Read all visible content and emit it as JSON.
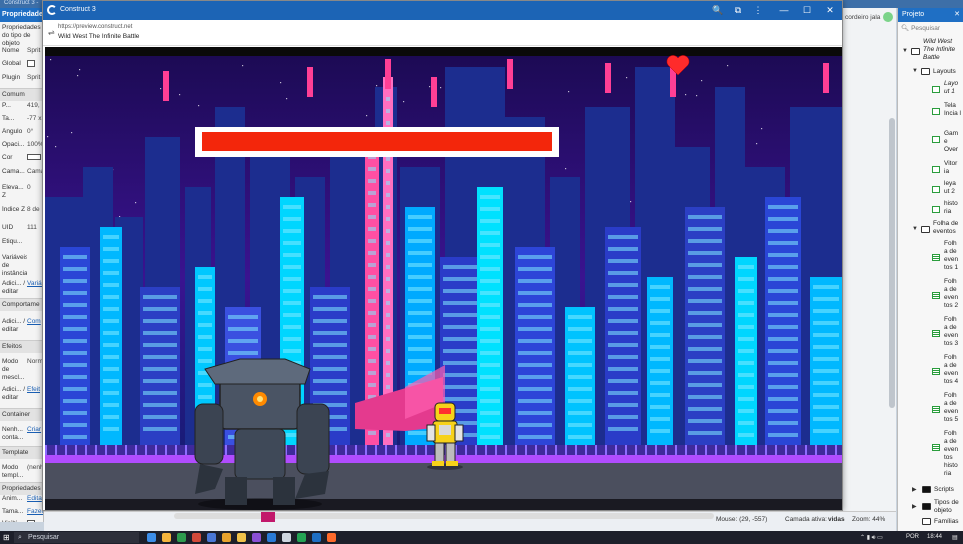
{
  "editor": {
    "top_left_title": "Construct 3 -",
    "right_tab": "cordeiro jala"
  },
  "properties_panel": {
    "header": "Propriedades",
    "subheader": "Propriedades do tipo de objeto",
    "rows": [
      {
        "label": "Nome",
        "value": "Sprit"
      },
      {
        "label": "Global",
        "value": ""
      },
      {
        "label": "Plugin",
        "value": "Sprit"
      },
      {
        "section": "Comum"
      },
      {
        "label": "P...",
        "value": "419,"
      },
      {
        "label": "Ta...",
        "value": "-77 x"
      },
      {
        "label": "Ângulo",
        "value": "0°"
      },
      {
        "label": "Opaci...",
        "value": "100%"
      },
      {
        "label": "Cor",
        "value": ""
      },
      {
        "label": "Cama...",
        "value": "Cama"
      },
      {
        "label": "Eleva... Z",
        "value": "0"
      },
      {
        "label": "Índice Z",
        "value": "8 de"
      },
      {
        "label": "UID",
        "value": "111"
      },
      {
        "label": "Etiqu...",
        "value": ""
      },
      {
        "label": "Variáveis de instância",
        "value": ""
      },
      {
        "label": "Adici... / editar",
        "value": "Variá de inst"
      },
      {
        "section": "Comportame"
      },
      {
        "label": "Adici... / editar",
        "value": "Com"
      },
      {
        "section": "Efeitos"
      },
      {
        "label": "Modo de mescl...",
        "value": "Norm"
      },
      {
        "label": "Adici... / editar",
        "value": "Efeit"
      },
      {
        "section": "Container"
      },
      {
        "label": "Nenh... conta...",
        "value": "Criar"
      },
      {
        "section": "Template"
      },
      {
        "label": "Modo templ...",
        "value": "(nenh"
      },
      {
        "section": "Propriedades"
      },
      {
        "label": "Anim...",
        "value": "Edita"
      },
      {
        "label": "Tama...",
        "value": "Fazer 1:1"
      },
      {
        "label": "Visibi...",
        "value": ""
      }
    ]
  },
  "preview_window": {
    "app_title": "Construct 3",
    "url": "https://preview.construct.net",
    "page_title": "Wild West The Infinite Battle",
    "buttons": {
      "zoom": "🔍",
      "extension": "⧉",
      "menu": "⋮",
      "minimize": "—",
      "maximize": "☐",
      "close": "✕"
    }
  },
  "game": {
    "health_bar_fraction": 1.0,
    "health_bar_color": "#f3260b",
    "sky_color": "#2a0f6e",
    "city_colors": [
      "#1e2a8c",
      "#00c3ff",
      "#ff3b8a",
      "#7a2bd6"
    ],
    "lives": 1
  },
  "status_bar": {
    "mouse": "Mouse: (29, -557)",
    "layer_label": "Camada ativa:",
    "layer_value": "vidas",
    "zoom": "Zoom: 44%"
  },
  "project_panel": {
    "header": "Projeto",
    "search_placeholder": "Pesquisar",
    "root": "Wild West The Infinite Battle",
    "layouts_folder": "Layouts",
    "layouts": [
      "Layo ut 1",
      "Tela Incia l",
      "Gam e Over",
      "Vitor ia",
      "leya ut 2",
      "histo ria"
    ],
    "events_folder": "Folha de eventos",
    "event_sheets": [
      "Folh a de even tos 1",
      "Folh a de even tos 2",
      "Folh a de even tos 3",
      "Folh a de even tos 4",
      "Folh a de even tos 5",
      "Folh a de even tos histo ria"
    ],
    "scripts": "Scripts",
    "object_types": "Tipos de objeto",
    "families": "Famílias"
  },
  "taskbar": {
    "search": "Pesquisar",
    "lang": "POR",
    "time": "18:44"
  }
}
